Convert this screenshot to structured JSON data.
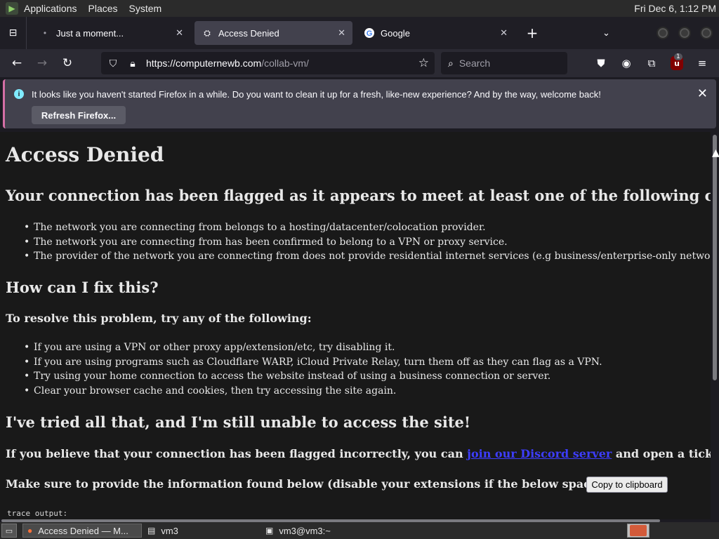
{
  "top_panel": {
    "menus": [
      "Applications",
      "Places",
      "System"
    ],
    "clock": "Fri Dec  6,  1:12 PM"
  },
  "tabs": [
    {
      "title": "Just a moment...",
      "icon": "loading-icon",
      "active": false
    },
    {
      "title": "Access Denied",
      "icon": "collabvm-icon",
      "active": true
    },
    {
      "title": "Google",
      "icon": "google-icon",
      "active": false
    }
  ],
  "navbar": {
    "url_host": "https://computernewb.com",
    "url_path": "/collab-vm/",
    "search_placeholder": "Search",
    "ublock_badge": "1"
  },
  "notification": {
    "message": "It looks like you haven't started Firefox in a while. Do you want to clean it up for a fresh, like-new experience? And by the way, welcome back!",
    "button": "Refresh Firefox..."
  },
  "page": {
    "title": "Access Denied",
    "flagged_heading": "Your connection has been flagged as it appears to meet at least one of the following criteria:",
    "criteria": [
      "The network you are connecting from belongs to a hosting/datacenter/colocation provider.",
      "The network you are connecting from has been confirmed to belong to a VPN or proxy service.",
      "The provider of the network you are connecting from does not provide residential internet services (e.g business/enterprise-only networks)."
    ],
    "fix_heading": "How can I fix this?",
    "resolve_heading": "To resolve this problem, try any of the following:",
    "fixes": [
      "If you are using a VPN or other proxy app/extension/etc, try disabling it.",
      "If you are using programs such as Cloudflare WARP, iCloud Private Relay, turn them off as they can flag as a VPN.",
      "Try using your home connection to access the website instead of using a business connection or server.",
      "Clear your browser cache and cookies, then try accessing the site again."
    ],
    "tried_heading": "I've tried all that, and I'm still unable to access the site!",
    "flagged_incorrect_pre": "If you believe that your connection has been flagged incorrectly, you can ",
    "discord_link": "join our Discord server",
    "flagged_incorrect_post": " and open a ticket.",
    "provide_info": "Make sure to provide the information found below (disable your extensions if the below space is empty):",
    "copy_button": "Copy to clipboard",
    "trace_label": "trace output:"
  },
  "taskbar": {
    "tasks": [
      {
        "label": "Access Denied — M...",
        "icon": "firefox-icon",
        "active": true
      },
      {
        "label": "vm3",
        "icon": "folder-icon",
        "active": false
      },
      {
        "label": "vm3@vm3:~",
        "icon": "terminal-icon",
        "active": false
      }
    ]
  },
  "colors": {
    "page_bg": "#191919",
    "toolbar_bg": "#2b2a33",
    "notice_bg": "#42414d",
    "link": "#3d3dff"
  }
}
